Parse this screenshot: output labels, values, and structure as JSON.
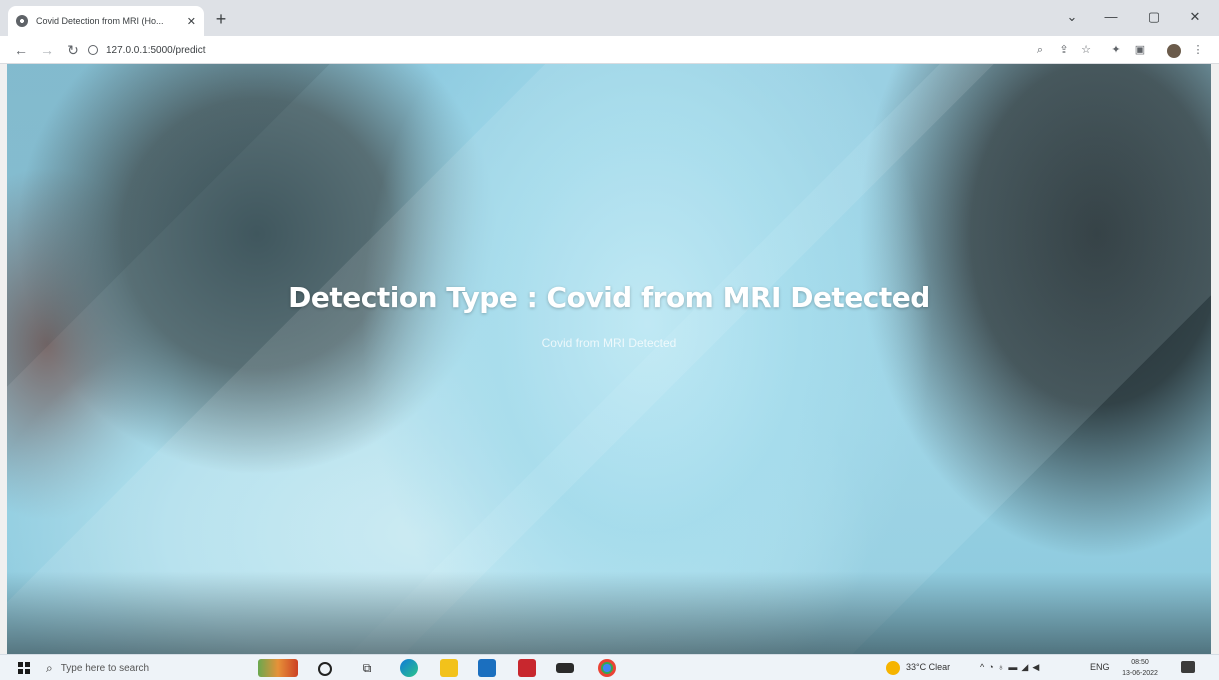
{
  "browser": {
    "tab_title": "Covid Detection from MRI (Ho...",
    "tab_close": "✕",
    "new_tab": "+",
    "url": "127.0.0.1:5000/predict",
    "controls": {
      "dropdown": "⌄",
      "minimize": "—",
      "maximize": "▢",
      "close": "✕"
    },
    "nav": {
      "back": "←",
      "forward": "→",
      "reload": "↻"
    },
    "toolbar_icons": [
      "zoom-icon",
      "share-icon",
      "star-icon",
      "extensions-icon",
      "sidepanel-icon",
      "profile-avatar",
      "menu-icon"
    ]
  },
  "page": {
    "heading": "Detection Type : Covid from MRI Detected",
    "subheading": "Covid from MRI Detected"
  },
  "taskbar": {
    "search_placeholder": "Type here to search",
    "weather": "33°C  Clear",
    "language": "ENG",
    "time": "08:50",
    "date": "13-06-2022"
  }
}
